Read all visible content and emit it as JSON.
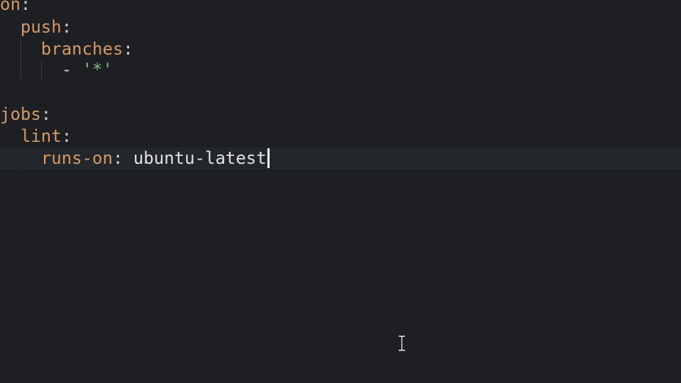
{
  "editor": {
    "lines": [
      {
        "key": "on",
        "punct": ":"
      },
      {
        "key": "push",
        "punct": ":"
      },
      {
        "key": "branches",
        "punct": ":"
      },
      {
        "dash": "-",
        "string": "'*'"
      },
      {},
      {
        "key": "jobs",
        "punct": ":"
      },
      {
        "key": "lint",
        "punct": ":"
      },
      {
        "key": "runs-on",
        "punct": ":",
        "value": "ubuntu-latest"
      }
    ]
  },
  "colors": {
    "background": "#1d1f23",
    "key": "#d19a66",
    "string": "#7fb87f",
    "current_line": "#23262b"
  },
  "icons": {
    "mouse_pointer": "i-beam-cursor-icon"
  }
}
